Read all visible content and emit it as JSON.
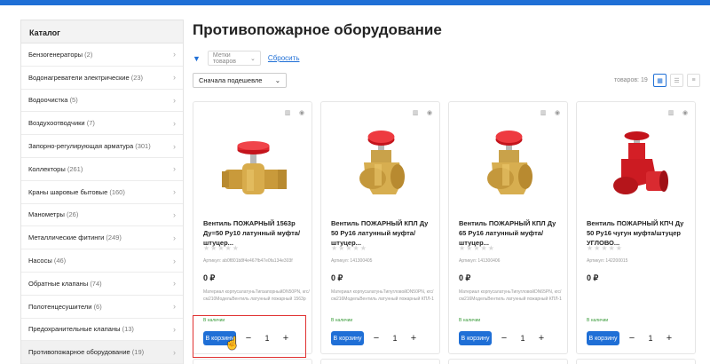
{
  "sidebar": {
    "header": "Каталог",
    "items": [
      {
        "label": "Бензогенераторы",
        "count": "(2)"
      },
      {
        "label": "Водонагреватели электрические",
        "count": "(23)"
      },
      {
        "label": "Водоочистка",
        "count": "(5)"
      },
      {
        "label": "Воздухоотводчики",
        "count": "(7)"
      },
      {
        "label": "Запорно-регулирующая арматура",
        "count": "(301)"
      },
      {
        "label": "Коллекторы",
        "count": "(261)"
      },
      {
        "label": "Краны шаровые бытовые",
        "count": "(160)"
      },
      {
        "label": "Манометры",
        "count": "(26)"
      },
      {
        "label": "Металлические фитинги",
        "count": "(249)"
      },
      {
        "label": "Насосы",
        "count": "(46)"
      },
      {
        "label": "Обратные клапаны",
        "count": "(74)"
      },
      {
        "label": "Полотенцесушители",
        "count": "(6)"
      },
      {
        "label": "Предохранительные клапаны",
        "count": "(13)"
      },
      {
        "label": "Противопожарное оборудование",
        "count": "(19)"
      }
    ]
  },
  "page": {
    "title": "Противопожарное оборудование",
    "tags_placeholder": "Метки товаров",
    "reset": "Сбросить",
    "sort": "Сначала подешевле",
    "count": "товаров: 19"
  },
  "products": [
    {
      "name": "Вентиль ПОЖАРНЫЙ 1563р Ду=50 Ру10 латунный муфта/штуцер...",
      "sku": "Артикул: ab0f801b8f4e467fb47e0fa134e303f",
      "price": "0 ₽",
      "desc": "Материал корпусалатуньТипзапорныйDN50PN, кгс/см210МодельВентиль латунный пожарный 1563р РN 10,...",
      "stock": "В наличии",
      "buy": "В корзину",
      "qty": "1"
    },
    {
      "name": "Вентиль ПОЖАРНЫЙ КПЛ Ду 50 Ру16 латунный муфта/штуцер...",
      "sku": "Артикул: 141300405",
      "price": "0 ₽",
      "desc": "Материал корпусалатуньТипугловойDN50PN, кгс/см216МодельВентиль латунный пожарный КПЛ-1 РN 16,...",
      "stock": "В наличии",
      "buy": "В корзину",
      "qty": "1"
    },
    {
      "name": "Вентиль ПОЖАРНЫЙ КПЛ Ду 65 Ру16 латунный муфта/штуцер...",
      "sku": "Артикул: 141300406",
      "price": "0 ₽",
      "desc": "Материал корпусалатуньТипугловойDN65PN, кгс/см216МодельВентиль латунный пожарный КПЛ-1 РN 16,...",
      "stock": "В наличии",
      "buy": "В корзину",
      "qty": "1"
    },
    {
      "name": "Вентиль ПОЖАРНЫЙ КПЧ Ду 50 Ру16 чугун муфта/штуцер УГЛОВО...",
      "sku": "Артикул: 142200015",
      "price": "0 ₽",
      "desc": "",
      "stock": "В наличии",
      "buy": "В корзину",
      "qty": "1"
    }
  ],
  "icons": {
    "compare": "bar-chart-icon",
    "quickview": "eye-icon",
    "filter": "filter-icon",
    "chevron": "chevron-right-icon",
    "cursor": "hand-cursor-icon"
  },
  "colors": {
    "accent": "#1f6fd6",
    "stock": "#3a9b3a",
    "highlight": "#e03030"
  }
}
